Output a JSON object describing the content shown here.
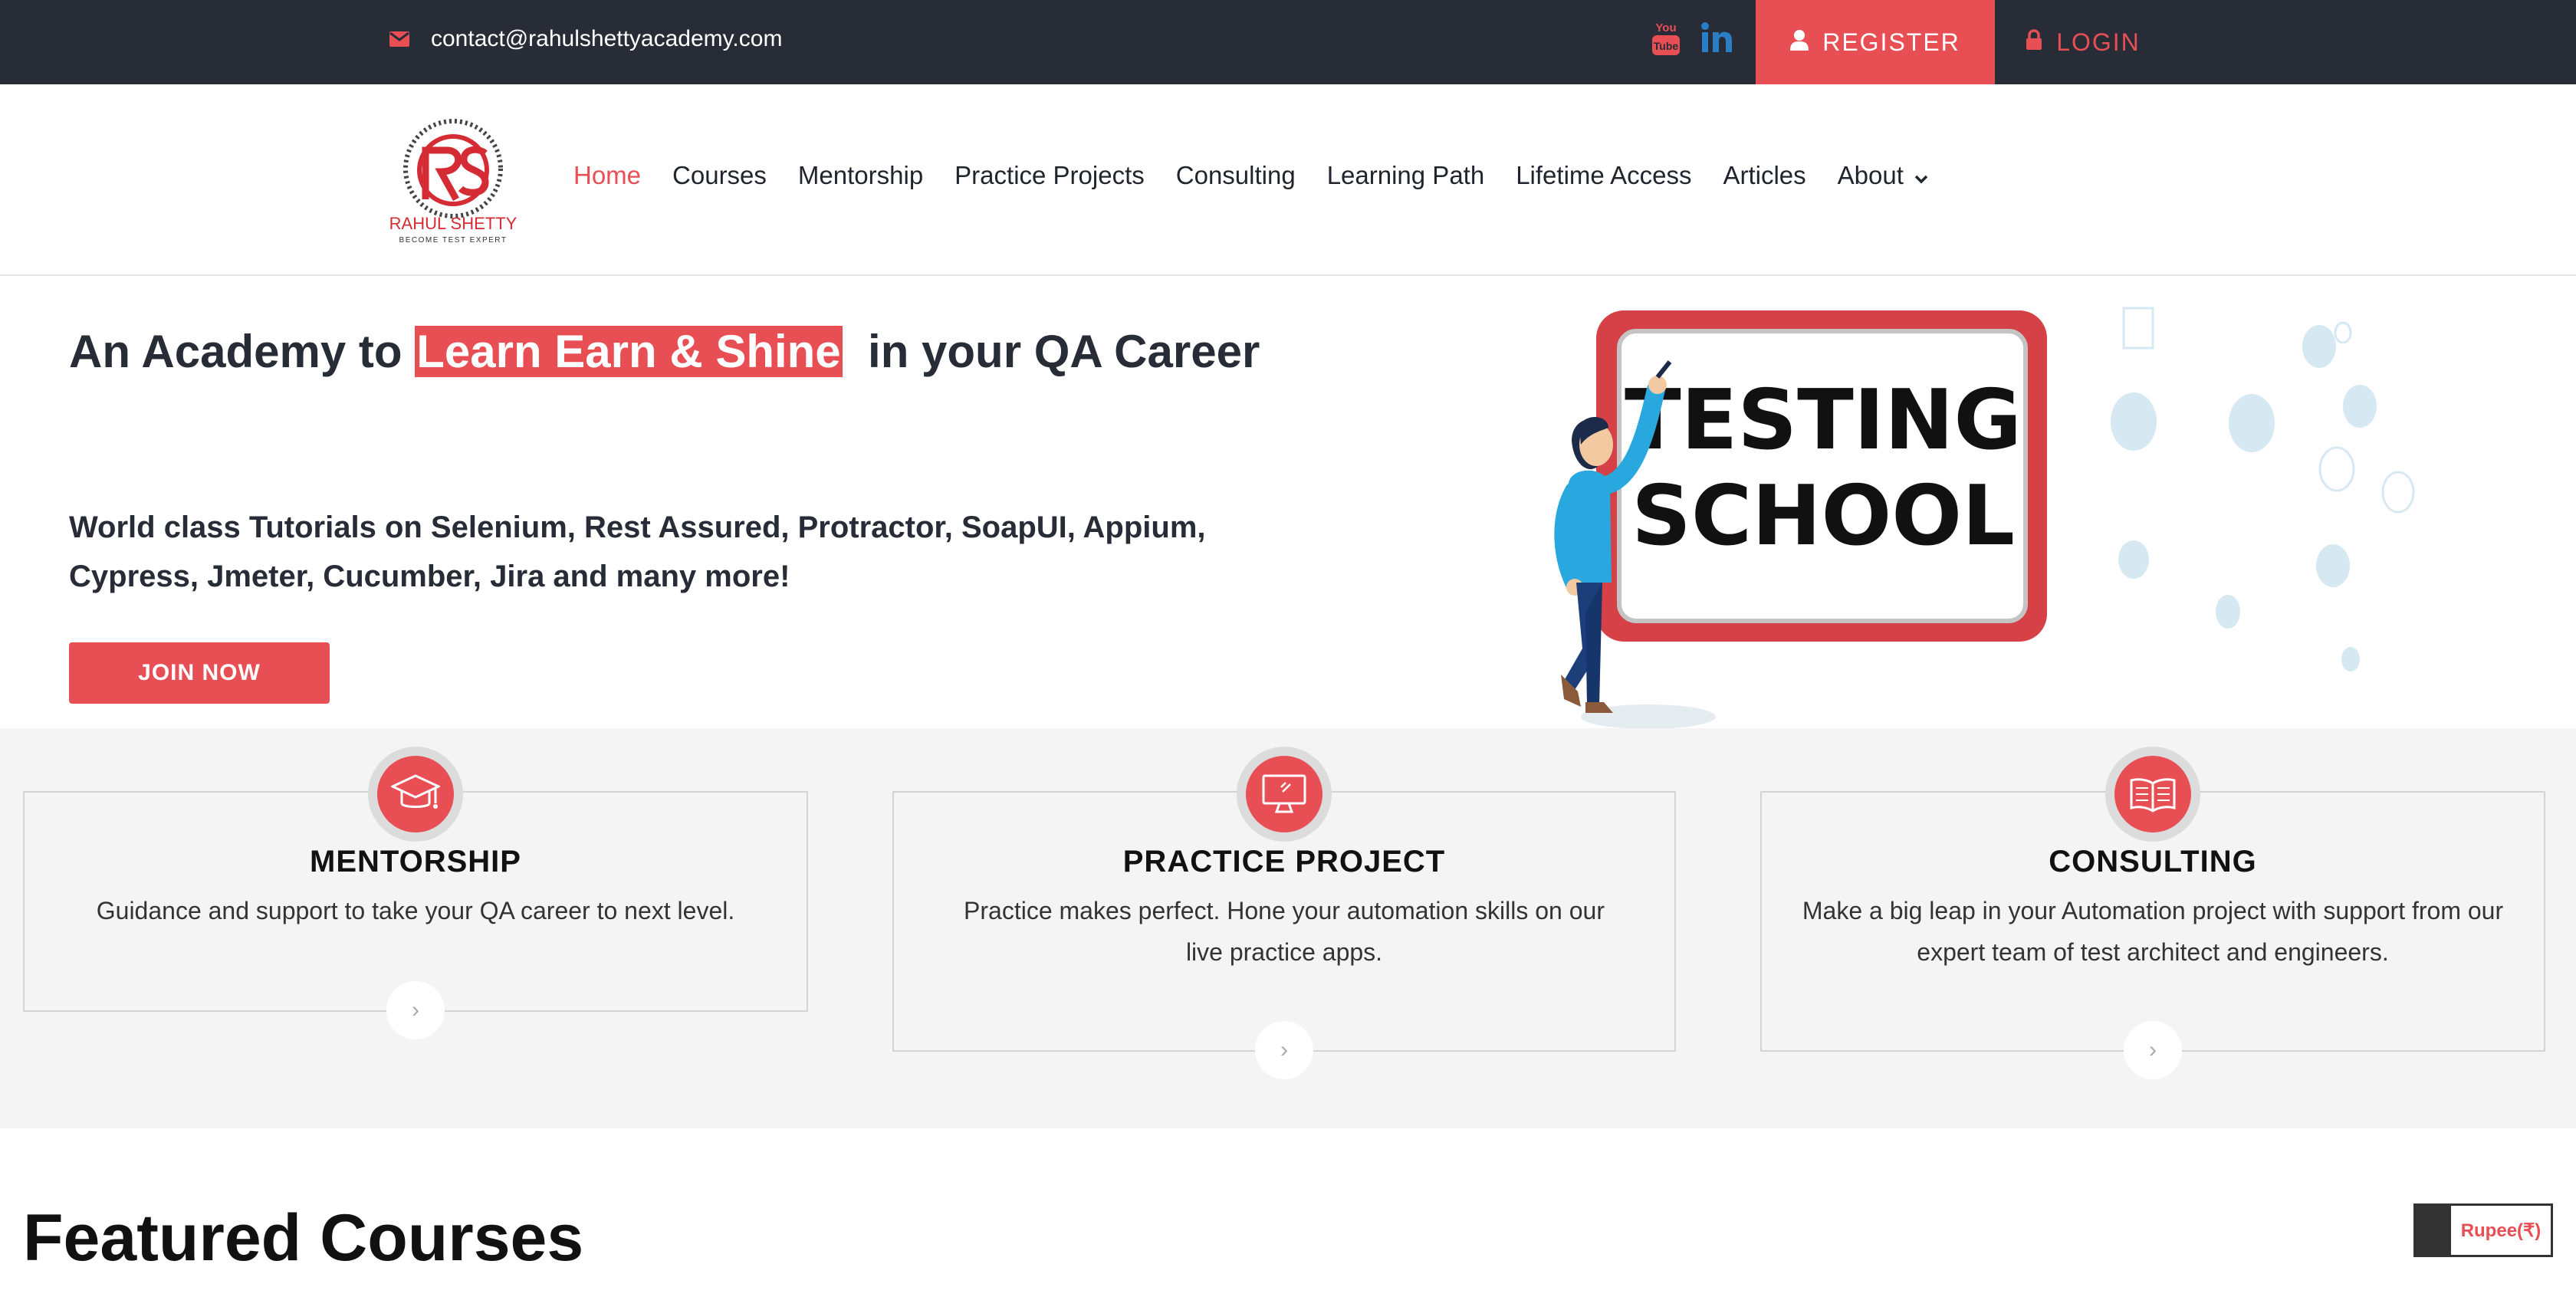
{
  "topbar": {
    "email": "contact@rahulshettyacademy.com",
    "youtube_icon": "youtube-icon",
    "linkedin_icon": "linkedin-icon",
    "register_label": "REGISTER",
    "login_label": "LOGIN"
  },
  "brand": {
    "logo_text": "RAHUL SHETTY",
    "logo_tagline": "BECOME TEST EXPERT",
    "accent_color": "#e84f55",
    "dark_color": "#272c37"
  },
  "nav": {
    "items": [
      {
        "label": "Home",
        "active": true
      },
      {
        "label": "Courses"
      },
      {
        "label": "Mentorship"
      },
      {
        "label": "Practice Projects"
      },
      {
        "label": "Consulting"
      },
      {
        "label": "Learning Path"
      },
      {
        "label": "Lifetime Access"
      },
      {
        "label": "Articles"
      },
      {
        "label": "About"
      }
    ]
  },
  "hero": {
    "title_before": "An Academy to ",
    "title_highlight": "Learn Earn & Shine",
    "title_after": "  in your QA Career",
    "subtitle": "World class Tutorials on Selenium, Rest Assured, Protractor, SoapUI, Appium, Cypress, Jmeter, Cucumber, Jira and many more!",
    "cta_label": "JOIN NOW",
    "board_line1": "TESTING",
    "board_line2": "SCHOOL"
  },
  "features": [
    {
      "title": "MENTORSHIP",
      "text": "Guidance and support to take your QA career to next level.",
      "icon": "graduation-cap-icon"
    },
    {
      "title": "PRACTICE PROJECT",
      "text": "Practice makes perfect. Hone your automation skills on our live practice apps.",
      "icon": "monitor-icon"
    },
    {
      "title": "CONSULTING",
      "text": "Make a big leap in your Automation project with support from our expert team of test architect and engineers.",
      "icon": "book-icon"
    }
  ],
  "featured": {
    "title": "Featured Courses"
  },
  "currency_toggle": {
    "label": "Rupee(₹)"
  }
}
